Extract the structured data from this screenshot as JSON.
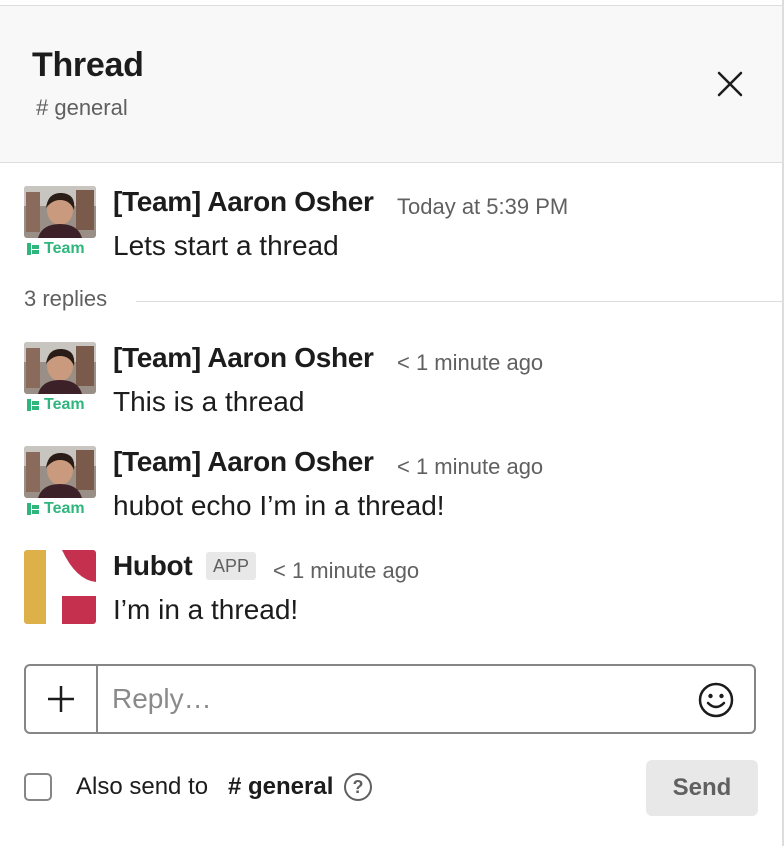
{
  "header": {
    "title": "Thread",
    "channel": "# general"
  },
  "parent_message": {
    "author": "[Team] Aaron Osher",
    "time": "Today at 5:39 PM",
    "text": "Lets start a thread",
    "tag": "Team"
  },
  "replies_label": "3 replies",
  "replies": [
    {
      "author": "[Team] Aaron Osher",
      "time": "< 1 minute ago",
      "text": "This is a thread",
      "tag": "Team"
    },
    {
      "author": "[Team] Aaron Osher",
      "time": "< 1 minute ago",
      "text": "hubot echo I’m in a thread!",
      "tag": "Team"
    },
    {
      "author": "Hubot",
      "badge": "APP",
      "time": "< 1 minute ago",
      "text": "I’m in a thread!"
    }
  ],
  "composer": {
    "placeholder": "Reply…"
  },
  "also_send": {
    "label": "Also send to",
    "channel": "# general",
    "help": "?"
  },
  "send_label": "Send",
  "colors": {
    "team_green": "#2eb67d",
    "hubot_yellow": "#ddb04a",
    "hubot_red": "#c5304f"
  }
}
